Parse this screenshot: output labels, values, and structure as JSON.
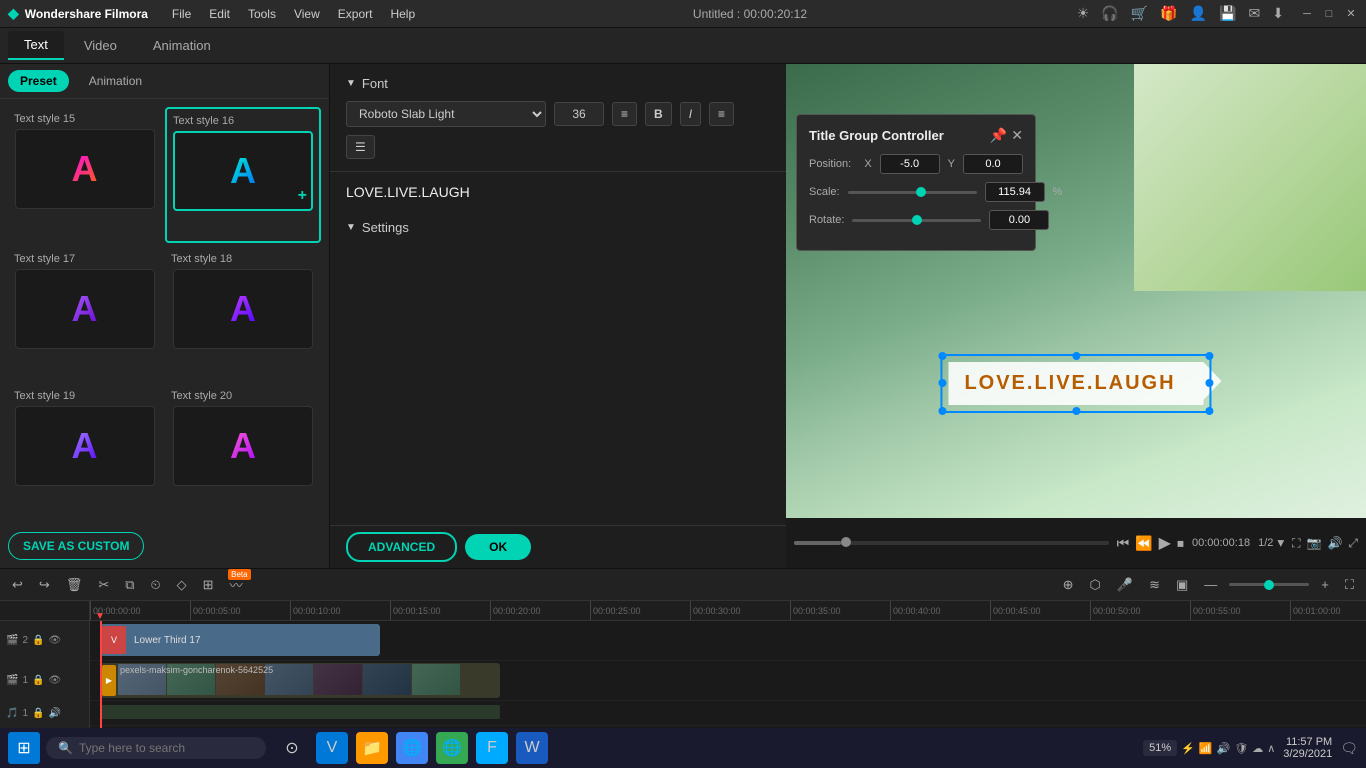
{
  "app": {
    "name": "Wondershare Filmora",
    "title": "Untitled : 00:00:20:12"
  },
  "menu": {
    "file": "File",
    "edit": "Edit",
    "tools": "Tools",
    "view": "View",
    "export": "Export",
    "help": "Help"
  },
  "tabs": {
    "text": "Text",
    "video": "Video",
    "animation": "Animation"
  },
  "subtabs": {
    "preset": "Preset",
    "animation": "Animation"
  },
  "styles": [
    {
      "id": 15,
      "label": "Text style 15"
    },
    {
      "id": 16,
      "label": "Text style 16"
    },
    {
      "id": 17,
      "label": "Text style 17"
    },
    {
      "id": 18,
      "label": "Text style 18"
    },
    {
      "id": 19,
      "label": "Text style 19"
    },
    {
      "id": 20,
      "label": "Text style 20"
    }
  ],
  "save_custom": "SAVE AS CUSTOM",
  "font": {
    "section_label": "Font",
    "font_name": "Roboto Slab Light",
    "font_size": "36",
    "text_content": "LOVE.LIVE.LAUGH"
  },
  "settings": {
    "section_label": "Settings"
  },
  "buttons": {
    "advanced": "ADVANCED",
    "ok": "OK"
  },
  "title_group_controller": {
    "title": "Title Group Controller",
    "position_label": "Position:",
    "x_label": "X",
    "x_value": "-5.0",
    "y_label": "Y",
    "y_value": "0.0",
    "scale_label": "Scale:",
    "scale_value": "115.94",
    "scale_unit": "%",
    "rotate_label": "Rotate:",
    "rotate_value": "0.00"
  },
  "preview": {
    "text_overlay": "LOVE.LIVE.LAUGH",
    "time_current": "00:00:00:18",
    "page_indicator": "1/2"
  },
  "timeline": {
    "time_markers": [
      "00:00:00:00",
      "00:00:05:00",
      "00:00:10:00",
      "00:00:15:00",
      "00:00:20:00",
      "00:00:25:00",
      "00:00:30:00",
      "00:00:35:00",
      "00:00:40:00",
      "00:00:45:00",
      "00:00:50:00",
      "00:00:55:00",
      "00:01:00:00"
    ],
    "clip_title": "Lower Third 17",
    "clip_video": "pexels-maksim-goncharenok-5642525"
  },
  "taskbar": {
    "search_placeholder": "Type here to search",
    "clock": "11:57 PM",
    "date": "3/29/2021",
    "battery": "51%"
  }
}
